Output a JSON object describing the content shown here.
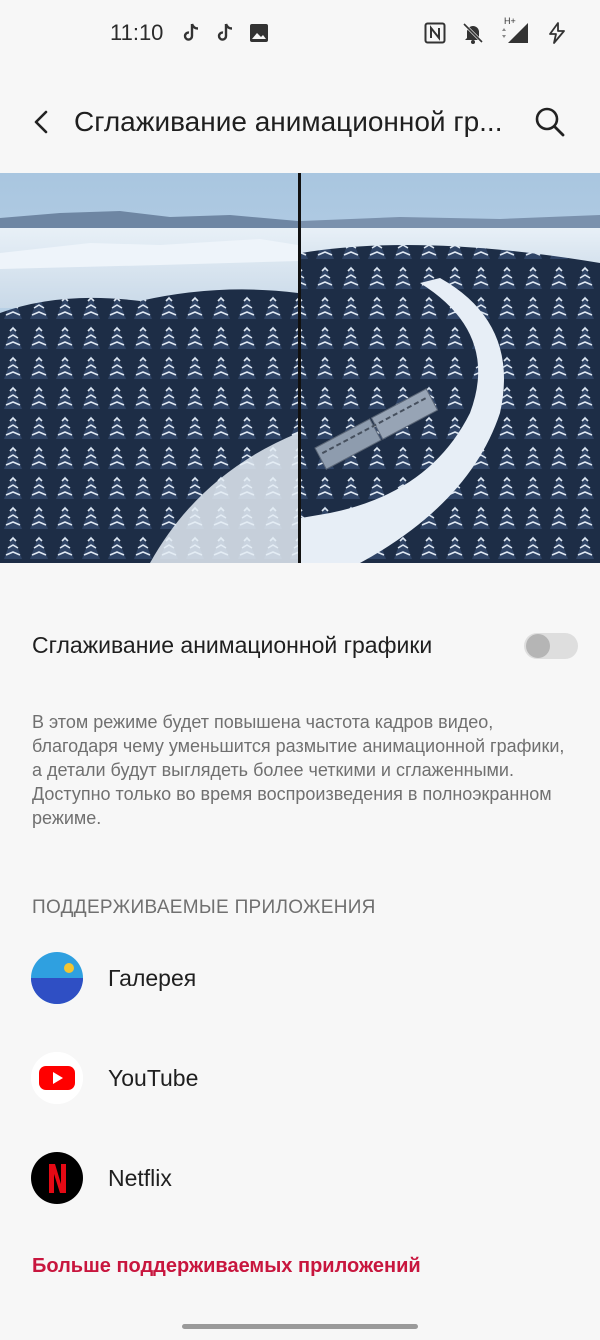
{
  "status_bar": {
    "time": "11:10",
    "left_icons": [
      "tiktok-icon",
      "tiktok-icon",
      "image-icon"
    ],
    "right_icons": [
      "nfc-icon",
      "bell-off-icon",
      "signal-h-plus-icon",
      "charging-icon"
    ],
    "network_label": "H+"
  },
  "app_bar": {
    "title": "Сглаживание анимационной гр...",
    "back_icon": "back-arrow-icon",
    "search_icon": "search-icon"
  },
  "setting": {
    "label": "Сглаживание анимационной графики",
    "enabled": false,
    "description": "В этом режиме будет повышена частота кадров видео, благодаря чему уменьшится размытие анимационной графики, а детали будут выглядеть более четкими и сглаженными. Доступно только во время воспроизведения в полноэкранном режиме."
  },
  "supported_apps": {
    "header": "ПОДДЕРЖИВАЕМЫЕ ПРИЛОЖЕНИЯ",
    "items": [
      {
        "name": "Галерея",
        "icon": "gallery-icon"
      },
      {
        "name": "YouTube",
        "icon": "youtube-icon"
      },
      {
        "name": "Netflix",
        "icon": "netflix-icon"
      }
    ],
    "more_link": "Больше поддерживаемых приложений"
  },
  "colors": {
    "accent": "#c8163e",
    "background": "#f7f7f7",
    "youtube_red": "#ff0000",
    "netflix_red": "#e50914",
    "gallery_blue": "#2f4fc4",
    "gallery_sky": "#2fa0e0"
  }
}
